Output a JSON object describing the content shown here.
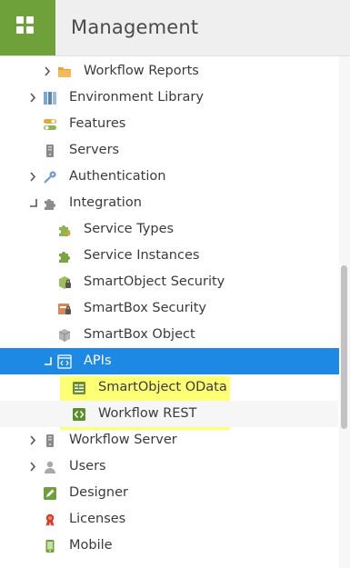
{
  "header": {
    "title": "Management"
  },
  "tree": {
    "workflow_reports": "Workflow Reports",
    "environment_library": "Environment Library",
    "features": "Features",
    "servers": "Servers",
    "authentication": "Authentication",
    "integration": "Integration",
    "service_types": "Service Types",
    "service_instances": "Service Instances",
    "smartobject_security": "SmartObject Security",
    "smartbox_security": "SmartBox Security",
    "smartbox_object": "SmartBox Object",
    "apis": "APIs",
    "smartobject_odata": "SmartObject OData",
    "workflow_rest": "Workflow REST",
    "workflow_server": "Workflow Server",
    "users": "Users",
    "designer": "Designer",
    "licenses": "Licenses",
    "mobile": "Mobile"
  },
  "colors": {
    "accent": "#6fa13a",
    "selected": "#1e88e5",
    "highlight": "#ffff00"
  },
  "icons": {
    "logo": "grid-icon",
    "workflow_reports": "folder-icon",
    "environment_library": "library-icon",
    "features": "toggle-icon",
    "servers": "server-icon",
    "authentication": "key-icon",
    "integration": "puzzle-icon",
    "service_types": "puzzle-icon",
    "service_instances": "puzzle-icon",
    "smartobject_security": "smartobject-lock-icon",
    "smartbox_security": "smartbox-lock-icon",
    "smartbox_object": "smartbox-icon",
    "apis": "api-icon",
    "smartobject_odata": "document-icon",
    "workflow_rest": "code-icon",
    "workflow_server": "server-icon",
    "users": "user-icon",
    "designer": "pencil-icon",
    "licenses": "ribbon-icon",
    "mobile": "mobile-icon"
  }
}
